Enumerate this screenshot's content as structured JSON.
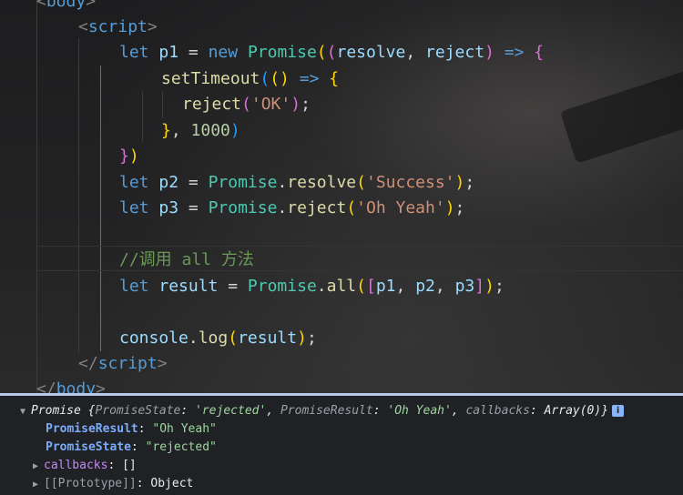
{
  "code": {
    "body_open": "body",
    "script_open": "script",
    "l1": {
      "let": "let",
      "name": "p1",
      "eq": "=",
      "new": "new",
      "cls": "Promise",
      "p1": "resolve",
      "comma": ",",
      "p2": "reject",
      "arrow": "=>"
    },
    "l2": {
      "fn": "setTimeout",
      "arrow": "=>"
    },
    "l3": {
      "fn": "reject",
      "str": "'OK'",
      "semi": ";"
    },
    "l4": {
      "close": "},",
      "num": "1000"
    },
    "l6": {
      "let": "let",
      "name": "p2",
      "eq": "=",
      "cls": "Promise",
      "dot": ".",
      "fn": "resolve",
      "str": "'Success'",
      "semi": ";"
    },
    "l7": {
      "let": "let",
      "name": "p3",
      "eq": "=",
      "cls": "Promise",
      "dot": ".",
      "fn": "reject",
      "str": "'Oh Yeah'",
      "semi": ";"
    },
    "comment": "//调用 all 方法",
    "l9": {
      "let": "let",
      "name": "result",
      "eq": "=",
      "cls": "Promise",
      "dot": ".",
      "fn": "all",
      "a1": "p1",
      "a2": "p2",
      "a3": "p3",
      "comma": ",",
      "semi": ";"
    },
    "l10": {
      "obj": "console",
      "dot": ".",
      "fn": "log",
      "arg": "result",
      "semi": ";"
    },
    "script_close": "script",
    "body_close": "body"
  },
  "console": {
    "header": {
      "cls": "Promise",
      "brace_open": "{",
      "k1": "PromiseState",
      "v1": "'rejected'",
      "k2": "PromiseResult",
      "v2": "'Oh Yeah'",
      "k3": "callbacks",
      "v3": "Array(0)",
      "brace_close": "}",
      "info": "i"
    },
    "rows": [
      {
        "key": "PromiseResult",
        "value": "\"Oh Yeah\""
      },
      {
        "key": "PromiseState",
        "value": "\"rejected\""
      },
      {
        "key": "callbacks",
        "value": "[]"
      },
      {
        "key": "[[Prototype]]",
        "value": "Object"
      }
    ]
  },
  "colors": {
    "keyword": "#569cd6",
    "variable": "#9cdcfe",
    "class": "#4ec9b0",
    "function": "#dcdcaa",
    "string": "#ce9178",
    "number": "#b5cea8",
    "comment": "#6a9955"
  }
}
